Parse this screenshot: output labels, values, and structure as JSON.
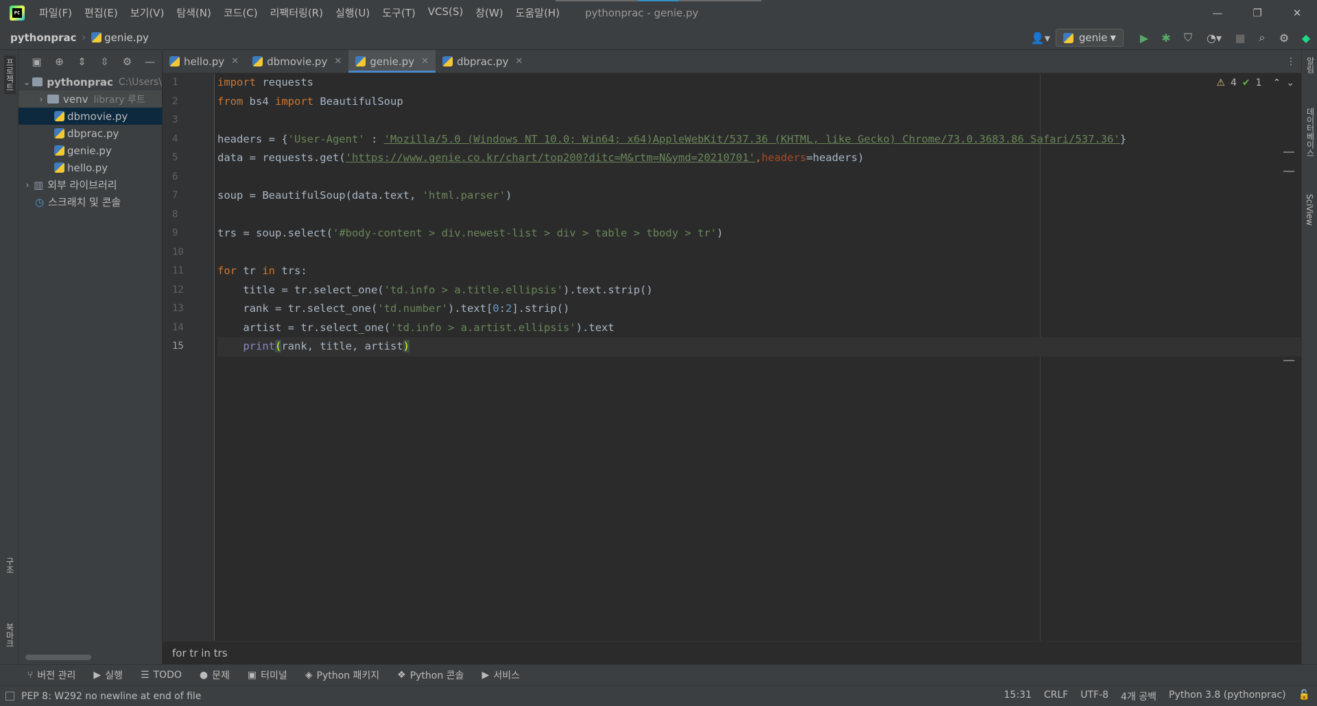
{
  "titlebar": {
    "menus": [
      "파일(F)",
      "편집(E)",
      "보기(V)",
      "탐색(N)",
      "코드(C)",
      "리팩터링(R)",
      "실행(U)",
      "도구(T)",
      "VCS(S)",
      "창(W)",
      "도움말(H)"
    ],
    "window_title": "pythonprac - genie.py",
    "controls": [
      "—",
      "❐",
      "✕"
    ]
  },
  "navbar": {
    "project": "pythonprac",
    "file": "genie.py",
    "run_config": "genie"
  },
  "left_strip": {
    "project_label": "프로젝트",
    "structure_label": "구조",
    "bookmarks_label": "북마크"
  },
  "project_tree": {
    "root": {
      "name": "pythonprac",
      "path": "C:\\Users\\"
    },
    "venv": {
      "name": "venv",
      "hint": "library 루트"
    },
    "files": [
      "dbmovie.py",
      "dbprac.py",
      "genie.py",
      "hello.py"
    ],
    "external": "외부 라이브러리",
    "scratches": "스크래치 및 콘솔"
  },
  "tabs": [
    {
      "label": "hello.py",
      "active": false
    },
    {
      "label": "dbmovie.py",
      "active": false
    },
    {
      "label": "genie.py",
      "active": true
    },
    {
      "label": "dbprac.py",
      "active": false
    }
  ],
  "inspections": {
    "warnings": "4",
    "ok": "1"
  },
  "line_numbers": [
    "1",
    "2",
    "3",
    "4",
    "5",
    "6",
    "7",
    "8",
    "9",
    "10",
    "11",
    "12",
    "13",
    "14",
    "15"
  ],
  "current_line": "15",
  "code": {
    "l1_kw": "import",
    "l1_rest": " requests",
    "l2_kw1": "from",
    "l2_mod": " bs4 ",
    "l2_kw2": "import",
    "l2_rest": " BeautifulSoup",
    "l4_a": "headers = {",
    "l4_key": "'User-Agent'",
    "l4_colon": " : ",
    "l4_val": "'Mozilla/5.0 (Windows NT 10.0; Win64; x64)AppleWebKit/537.36 (KHTML, like Gecko) Chrome/73.0.3683.86 Safari/537.36'",
    "l4_end": "}",
    "l5_a": "data = requests.get(",
    "l5_url": "'https://www.genie.co.kr/chart/top200?ditc=M&rtm=N&ymd=20210701'",
    "l5_comma": ",",
    "l5_param": "headers",
    "l5_end": "=headers)",
    "l7_a": "soup = BeautifulSoup(data.text, ",
    "l7_str": "'html.parser'",
    "l7_end": ")",
    "l9_a": "trs = soup.select(",
    "l9_str": "'#body-content > div.newest-list > div > table > tbody > tr'",
    "l9_end": ")",
    "l11_kw1": "for",
    "l11_mid": " tr ",
    "l11_kw2": "in",
    "l11_end": " trs:",
    "l12_a": "    title = tr.select_one(",
    "l12_str": "'td.info > a.title.ellipsis'",
    "l12_end": ").text.strip()",
    "l13_a": "    rank = tr.select_one(",
    "l13_str": "'td.number'",
    "l13_b": ").text[",
    "l13_n1": "0",
    "l13_c": ":",
    "l13_n2": "2",
    "l13_end": "].strip()",
    "l14_a": "    artist = tr.select_one(",
    "l14_str": "'td.info > a.artist.ellipsis'",
    "l14_end": ").text",
    "l15_indent": "    ",
    "l15_fn": "print",
    "l15_open": "(",
    "l15_args": "rank, title, artist",
    "l15_close": ")"
  },
  "editor_breadcrumb": "for tr in trs",
  "right_strip": {
    "notifications": "알림",
    "database": "데이터베이스",
    "sciview": "SciView"
  },
  "bottom_tools": [
    "버전 관리",
    "실행",
    "TODO",
    "문제",
    "터미널",
    "Python 패키지",
    "Python 콘솔",
    "서비스"
  ],
  "status": {
    "message": "PEP 8: W292 no newline at end of file",
    "position": "15:31",
    "line_sep": "CRLF",
    "encoding": "UTF-8",
    "indent": "4개 공백",
    "interpreter": "Python 3.8 (pythonprac)"
  }
}
